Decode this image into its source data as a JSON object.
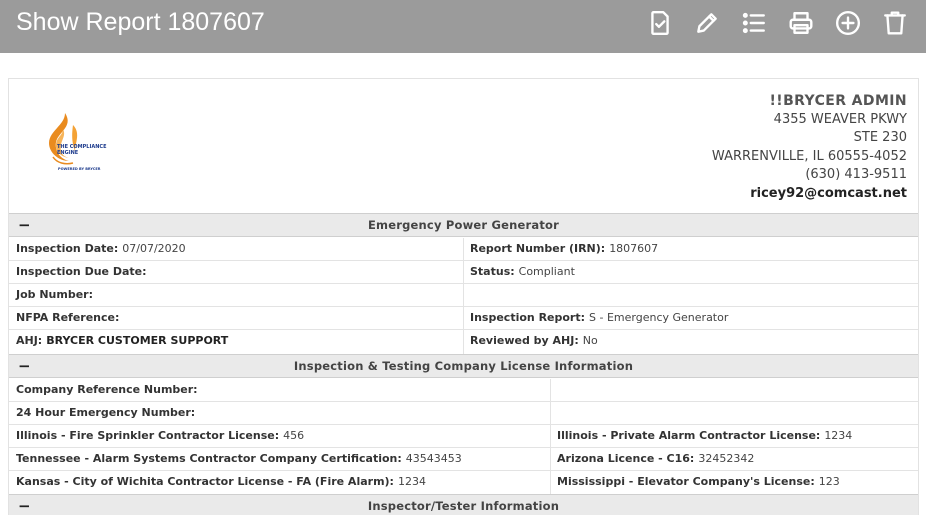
{
  "header": {
    "title": "Show Report 1807607",
    "actions": [
      {
        "name": "checklist-doc-icon"
      },
      {
        "name": "pencil-icon"
      },
      {
        "name": "list-icon"
      },
      {
        "name": "printer-icon"
      },
      {
        "name": "plus-circle-icon"
      },
      {
        "name": "trash-icon"
      }
    ],
    "bar_color": "#9b9b9b"
  },
  "company": {
    "logo_text": "THE COMPLIANCE ENGINE",
    "logo_sub": "POWERED BY BRYCER",
    "name": "!!BRYCER ADMIN",
    "address1": "4355 WEAVER PKWY",
    "address2": "STE 230",
    "city_line": "WARRENVILLE, IL 60555-4052",
    "phone": "(630) 413-9511",
    "email": "ricey92@comcast.net"
  },
  "sections": {
    "generator": {
      "title": "Emergency Power Generator",
      "toggle": "−",
      "rows": [
        {
          "l_label": "Inspection Date:",
          "l_value": "07/07/2020",
          "r_label": "Report Number (IRN):",
          "r_value": "1807607"
        },
        {
          "l_label": "Inspection Due Date:",
          "l_value": "",
          "r_label": "Status:",
          "r_value": "Compliant"
        },
        {
          "l_label": "Job Number:",
          "l_value": "",
          "r_label": "",
          "r_value": ""
        },
        {
          "l_label": "NFPA Reference:",
          "l_value": "",
          "r_label": "Inspection Report:",
          "r_value": "S - Emergency Generator"
        },
        {
          "l_label": "AHJ:",
          "l_value": "BRYCER CUSTOMER SUPPORT",
          "r_label": "Reviewed by AHJ:",
          "r_value": "No"
        }
      ]
    },
    "license": {
      "title": "Inspection & Testing Company License Information",
      "toggle": "−",
      "rows": [
        {
          "l_label": "Company Reference Number:",
          "l_value": "",
          "r_label": "",
          "r_value": ""
        },
        {
          "l_label": "24 Hour Emergency Number:",
          "l_value": "",
          "r_label": "",
          "r_value": ""
        },
        {
          "l_label": "Illinois - Fire Sprinkler Contractor License:",
          "l_value": "456",
          "r_label": "Illinois - Private Alarm Contractor License:",
          "r_value": "1234"
        },
        {
          "l_label": "Tennessee - Alarm Systems Contractor Company Certification:",
          "l_value": "43543453",
          "r_label": "Arizona Licence - C16:",
          "r_value": "32452342"
        },
        {
          "l_label": "Kansas - City of Wichita Contractor License - FA (Fire Alarm):",
          "l_value": "1234",
          "r_label": "Mississippi - Elevator Company's License:",
          "r_value": "123"
        }
      ]
    },
    "inspector": {
      "title": "Inspector/Tester Information",
      "toggle": "−"
    }
  }
}
